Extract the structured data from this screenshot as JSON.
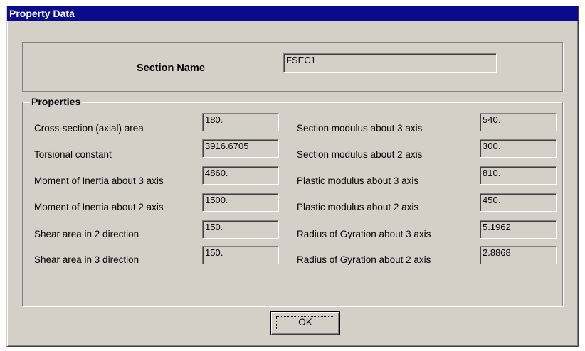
{
  "window": {
    "title": "Property Data"
  },
  "section": {
    "label": "Section Name",
    "value": "FSEC1"
  },
  "properties": {
    "legend": "Properties",
    "left": [
      {
        "label": "Cross-section (axial) area",
        "value": "180."
      },
      {
        "label": "Torsional constant",
        "value": "3916.6705"
      },
      {
        "label": "Moment of Inertia about 3 axis",
        "value": "4860."
      },
      {
        "label": "Moment of Inertia about 2 axis",
        "value": "1500."
      },
      {
        "label": "Shear area in 2 direction",
        "value": "150."
      },
      {
        "label": "Shear area in 3 direction",
        "value": "150."
      }
    ],
    "right": [
      {
        "label": "Section modulus about 3 axis",
        "value": "540."
      },
      {
        "label": "Section modulus about 2 axis",
        "value": "300."
      },
      {
        "label": "Plastic modulus about 3 axis",
        "value": "810."
      },
      {
        "label": "Plastic modulus about 2 axis",
        "value": "450."
      },
      {
        "label": "Radius of Gyration about 3 axis",
        "value": "5.1962"
      },
      {
        "label": "Radius of Gyration about 2 axis",
        "value": "2.8868"
      }
    ]
  },
  "buttons": {
    "ok": "OK"
  }
}
